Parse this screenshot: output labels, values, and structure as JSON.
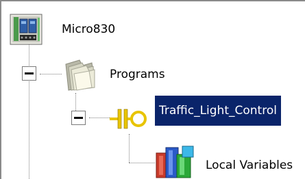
{
  "tree": {
    "controller": {
      "label": "Micro830",
      "icon": "controller-icon"
    },
    "programs": {
      "label": "Programs",
      "icon": "programs-folder-icon",
      "expanded": true
    },
    "program": {
      "label": "Traffic_Light_Control",
      "icon": "ladder-program-icon",
      "expanded": true,
      "selected": true
    },
    "local_variables": {
      "label": "Local Variables",
      "icon": "local-variables-icon"
    }
  },
  "colors": {
    "selection_bg": "#0a246a",
    "selection_text": "#ffffff",
    "tree_lines": "#808080"
  }
}
